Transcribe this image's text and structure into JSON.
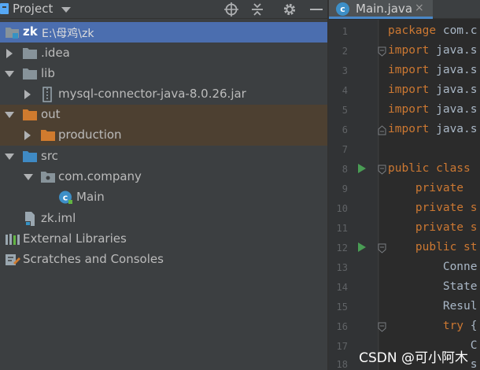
{
  "project_panel": {
    "title": "Project",
    "toolbar": [
      "target-icon",
      "collapse-icon",
      "gear-icon",
      "minimize-icon"
    ],
    "tree": [
      {
        "name": "zk",
        "path": "E:\\母鸡\\zk",
        "icon": "module-folder-icon",
        "expanded": true,
        "selected": true
      },
      {
        "name": ".idea",
        "icon": "folder-icon",
        "expanded": false
      },
      {
        "name": "lib",
        "icon": "folder-icon",
        "expanded": true
      },
      {
        "name": "mysql-connector-java-8.0.26.jar",
        "icon": "jar-icon",
        "expanded": false
      },
      {
        "name": "out",
        "icon": "excluded-folder-icon",
        "expanded": true
      },
      {
        "name": "production",
        "icon": "excluded-folder-icon",
        "expanded": false
      },
      {
        "name": "src",
        "icon": "source-folder-icon",
        "expanded": true
      },
      {
        "name": "com.company",
        "icon": "package-icon",
        "expanded": true
      },
      {
        "name": "Main",
        "icon": "java-class-icon"
      },
      {
        "name": "zk.iml",
        "icon": "iml-file-icon"
      },
      {
        "name": "External Libraries",
        "icon": "libraries-icon",
        "expanded": false
      },
      {
        "name": "Scratches and Consoles",
        "icon": "scratches-icon",
        "expanded": false
      }
    ]
  },
  "editor": {
    "tab": {
      "label": "Main.java",
      "close": "×",
      "icon": "java-class-icon"
    },
    "lines": [
      {
        "n": "1",
        "kw": "package",
        "rest": " com.c"
      },
      {
        "n": "2",
        "kw": "import",
        "rest": " java.s"
      },
      {
        "n": "3",
        "kw": "import",
        "rest": " java.s"
      },
      {
        "n": "4",
        "kw": "import",
        "rest": " java.s"
      },
      {
        "n": "5",
        "kw": "import",
        "rest": " java.s"
      },
      {
        "n": "6",
        "kw": "import",
        "rest": " java.s"
      },
      {
        "n": "7",
        "kw": "",
        "rest": ""
      },
      {
        "n": "8",
        "kw": "public class",
        "rest": ""
      },
      {
        "n": "9",
        "kw": "    private",
        "rest": ""
      },
      {
        "n": "10",
        "kw": "    private s",
        "rest": ""
      },
      {
        "n": "11",
        "kw": "    private s",
        "rest": ""
      },
      {
        "n": "12",
        "kw": "    public st",
        "rest": ""
      },
      {
        "n": "13",
        "kw": "",
        "rest": "        Conne"
      },
      {
        "n": "14",
        "kw": "",
        "rest": "        State"
      },
      {
        "n": "15",
        "kw": "",
        "rest": "        Resul"
      },
      {
        "n": "16",
        "kw": "        try",
        "rest": " {"
      },
      {
        "n": "17",
        "kw": "",
        "rest": "            C"
      },
      {
        "n": "18",
        "kw": "",
        "rest": "            s"
      }
    ]
  },
  "watermark": "CSDN @可小阿木",
  "colors": {
    "selection": "#4b6eaf",
    "excluded_row": "#4d4031",
    "keyword": "#cc7832",
    "run_gutter": "#499c54",
    "tab_underline": "#4a88c7"
  }
}
